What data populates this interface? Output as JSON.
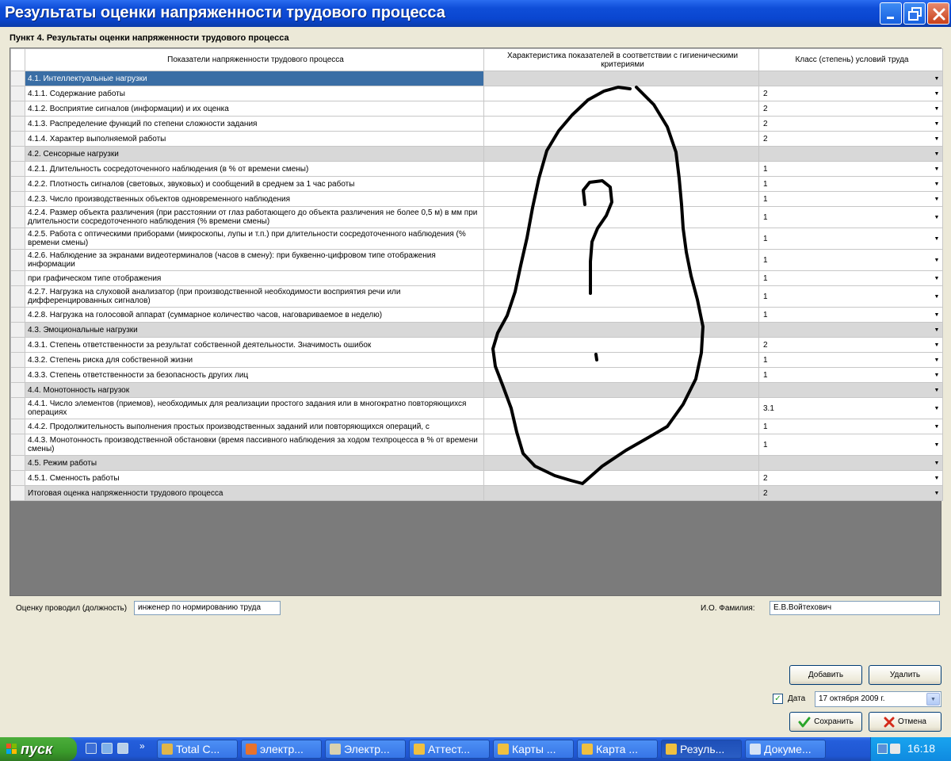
{
  "window": {
    "title": "Результаты оценки напряженности трудового процесса"
  },
  "section_title": "Пункт 4. Результаты оценки напряженности трудового процесса",
  "grid": {
    "columns": [
      "Показатели напряженности трудового процесса",
      "Характеристика показателей в соответствии с гигиеническими критериями",
      "Класс (степень) условий труда"
    ],
    "rows": [
      {
        "name": "4.1. Интеллектуальные нагрузки",
        "value": "",
        "group": true,
        "active": true
      },
      {
        "name": "4.1.1. Содержание работы",
        "value": "2"
      },
      {
        "name": "4.1.2. Восприятие сигналов (информации) и их оценка",
        "value": "2"
      },
      {
        "name": "4.1.3. Распределение функций по степени сложности задания",
        "value": "2"
      },
      {
        "name": "4.1.4. Характер выполняемой работы",
        "value": "2"
      },
      {
        "name": "4.2. Сенсорные нагрузки",
        "value": "",
        "group": true
      },
      {
        "name": "4.2.1. Длительность сосредоточенного наблюдения (в % от времени смены)",
        "value": "1"
      },
      {
        "name": "4.2.2. Плотность сигналов (световых, звуковых) и сообщений в среднем за 1 час работы",
        "value": "1"
      },
      {
        "name": "4.2.3. Число производственных объектов одновременного наблюдения",
        "value": "1"
      },
      {
        "name": "4.2.4. Размер объекта различения (при расстоянии от глаз работающего до объекта различения не более 0,5 м) в мм при длительности сосредоточенного наблюдения (% времени смены)",
        "value": "1",
        "tall": true
      },
      {
        "name": "4.2.5. Работа с оптическими приборами (микроскопы, лупы и т.п.) при длительности сосредоточенного наблюдения (% времени смены)",
        "value": "1",
        "tall": true
      },
      {
        "name": "4.2.6. Наблюдение за экранами видеотерминалов (часов в смену): при буквенно-цифровом типе отображения информации",
        "value": "1",
        "tall": true
      },
      {
        "name": "при графическом типе отображения",
        "value": "1"
      },
      {
        "name": "4.2.7. Нагрузка на слуховой анализатор (при производственной необходимости восприятия речи или дифференцированных сигналов)",
        "value": "1",
        "tall": true
      },
      {
        "name": "4.2.8. Нагрузка на голосовой аппарат (суммарное количество часов, наговариваемое в неделю)",
        "value": "1"
      },
      {
        "name": "4.3. Эмоциональные нагрузки",
        "value": "",
        "group": true
      },
      {
        "name": "4.3.1. Степень ответственности за результат собственной деятельности. Значимость ошибок",
        "value": "2"
      },
      {
        "name": "4.3.2. Степень риска для собственной жизни",
        "value": "1"
      },
      {
        "name": "4.3.3. Степень ответственности за безопасность других лиц",
        "value": "1"
      },
      {
        "name": "4.4. Монотонность нагрузок",
        "value": "",
        "group": true
      },
      {
        "name": "4.4.1. Число элементов (приемов), необходимых для реализации простого задания или в многократно повторяющихся операциях",
        "value": "3.1",
        "tall": true
      },
      {
        "name": "4.4.2. Продолжительность выполнения простых производственных заданий или повторяющихся операций, с",
        "value": "1"
      },
      {
        "name": "4.4.3. Монотонность производственной обстановки (время пассивного наблюдения за ходом техпроцесса в % от времени смены)",
        "value": "1",
        "tall": true
      },
      {
        "name": "4.5. Режим работы",
        "value": "",
        "group": true
      },
      {
        "name": "4.5.1. Сменность работы",
        "value": "2"
      },
      {
        "name": "Итоговая оценка напряженности трудового процесса",
        "value": "2",
        "total": true
      }
    ]
  },
  "form": {
    "assessor_label": "Оценку проводил (должность)",
    "assessor_value": "инженер по нормированию труда",
    "name_label": "И.О. Фамилия:",
    "name_value": "Е.В.Войтехович",
    "add_label": "Добавить",
    "delete_label": "Удалить",
    "date_label": "Дата",
    "date_checked": true,
    "date_value": "17  октября  2009 г.",
    "save_label": "Сохранить",
    "cancel_label": "Отмена"
  },
  "taskbar": {
    "start_label": "пуск",
    "items": [
      {
        "label": "Total C...",
        "color": "#e0b64a"
      },
      {
        "label": "электр...",
        "color": "#e8722c"
      },
      {
        "label": "Электр...",
        "color": "#d9d2b0"
      },
      {
        "label": "Аттест...",
        "color": "#f0c040"
      },
      {
        "label": "Карты ...",
        "color": "#f0c040"
      },
      {
        "label": "Карта ...",
        "color": "#f0c040"
      },
      {
        "label": "Резуль...",
        "color": "#f0c040",
        "active": true
      },
      {
        "label": "Докуме...",
        "color": "#d6e3f5"
      }
    ],
    "clock": "16:18"
  },
  "colors": {
    "titlebar": "#0a46d0",
    "selection": "#3a6ea5",
    "group_row": "#d8d8d8",
    "grid_empty": "#7b7b7b"
  }
}
